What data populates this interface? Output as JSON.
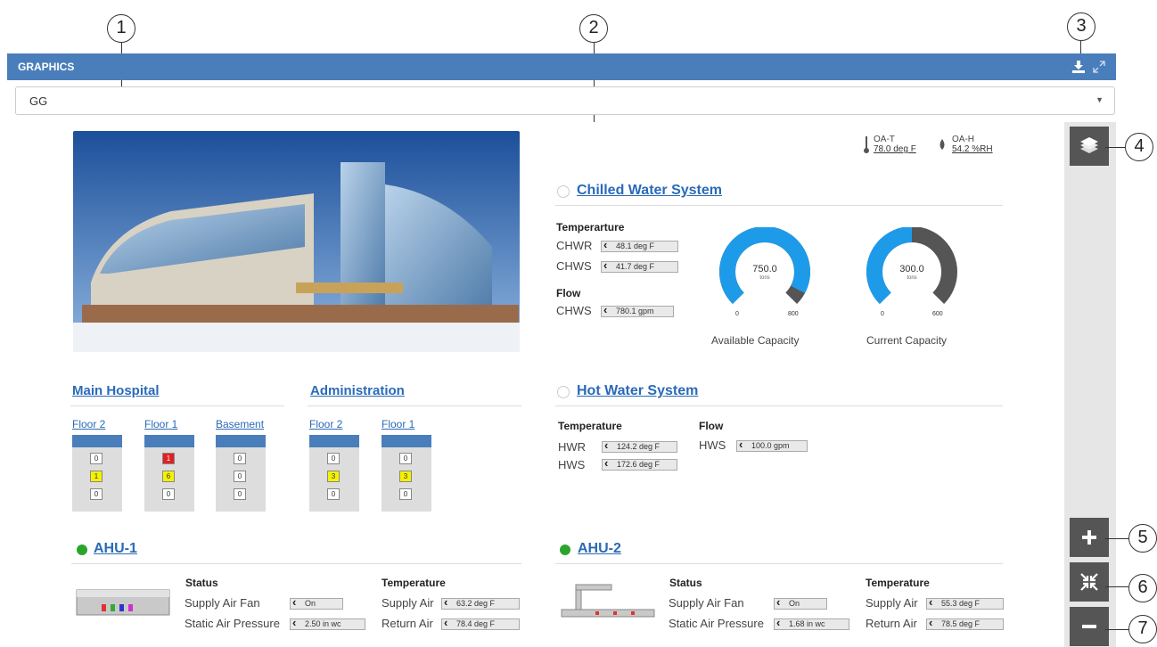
{
  "callouts": [
    "1",
    "2",
    "3",
    "4",
    "5",
    "6",
    "7"
  ],
  "header": {
    "title": "GRAPHICS",
    "download_icon": "download-icon",
    "expand_icon": "expand-icon"
  },
  "selector": {
    "value": "GG"
  },
  "weather": {
    "temp_label": "OA-T",
    "temp_value": "78.0 deg F",
    "hum_label": "OA-H",
    "hum_value": "54.2 %RH"
  },
  "chilled": {
    "title": "Chilled Water System",
    "temp_heading": "Temperarture",
    "chwr_label": "CHWR",
    "chwr_value": "48.1  deg F",
    "chws_label": "CHWS",
    "chws_value": "41.7  deg F",
    "flow_heading": "Flow",
    "flow_label": "CHWS",
    "flow_value": "780.1  gpm",
    "gauge1": {
      "value_text": "750.0",
      "unit": "tons",
      "min": "0",
      "max": "800",
      "label": "Available Capacity",
      "value": 750,
      "range": 800
    },
    "gauge2": {
      "value_text": "300.0",
      "unit": "tons",
      "min": "0",
      "max": "600",
      "label": "Current Capacity",
      "value": 300,
      "range": 600
    }
  },
  "hot": {
    "title": "Hot Water System",
    "temp_heading": "Temperature",
    "hwr_label": "HWR",
    "hwr_value": "124.2  deg F",
    "hws_label": "HWS",
    "hws_value": "172.6  deg F",
    "flow_heading": "Flow",
    "flow_label": "HWS",
    "flow_value": "100.0  gpm"
  },
  "buildings": {
    "main": {
      "title": "Main Hospital",
      "floors": [
        {
          "name": "Floor 2",
          "cells": [
            "0",
            "1",
            "0"
          ]
        },
        {
          "name": "Floor 1",
          "cells": [
            "1",
            "6",
            "0"
          ]
        },
        {
          "name": "Basement",
          "cells": [
            "0",
            "0",
            "0"
          ]
        }
      ]
    },
    "admin": {
      "title": "Administration",
      "floors": [
        {
          "name": "Floor 2",
          "cells": [
            "0",
            "3",
            "0"
          ]
        },
        {
          "name": "Floor 1",
          "cells": [
            "0",
            "3",
            "0"
          ]
        }
      ]
    }
  },
  "ahu1": {
    "title": "AHU-1",
    "status_heading": "Status",
    "temp_heading": "Temperature",
    "fan_label": "Supply Air Fan",
    "fan_value": "On",
    "pressure_label": "Static Air Pressure",
    "pressure_value": "2.50  in wc",
    "supply_label": "Supply Air",
    "supply_value": "63.2  deg F",
    "return_label": "Return Air",
    "return_value": "78.4  deg F"
  },
  "ahu2": {
    "title": "AHU-2",
    "status_heading": "Status",
    "temp_heading": "Temperature",
    "fan_label": "Supply Air Fan",
    "fan_value": "On",
    "pressure_label": "Static Air Pressure",
    "pressure_value": "1.68  in wc",
    "supply_label": "Supply Air",
    "supply_value": "55.3  deg F",
    "return_label": "Return Air",
    "return_value": "78.5  deg F"
  },
  "rail": {
    "layers_icon": "layers-icon",
    "zoom_in_icon": "plus-icon",
    "fit_icon": "compress-icon",
    "zoom_out_icon": "minus-icon"
  },
  "colors": {
    "header": "#4a7ebb",
    "gauge_blue": "#1e9be8",
    "gauge_gray": "#555555",
    "status_green": "#2aa52a",
    "alarm_red": "#e02020",
    "alarm_yellow": "#f5f200"
  }
}
